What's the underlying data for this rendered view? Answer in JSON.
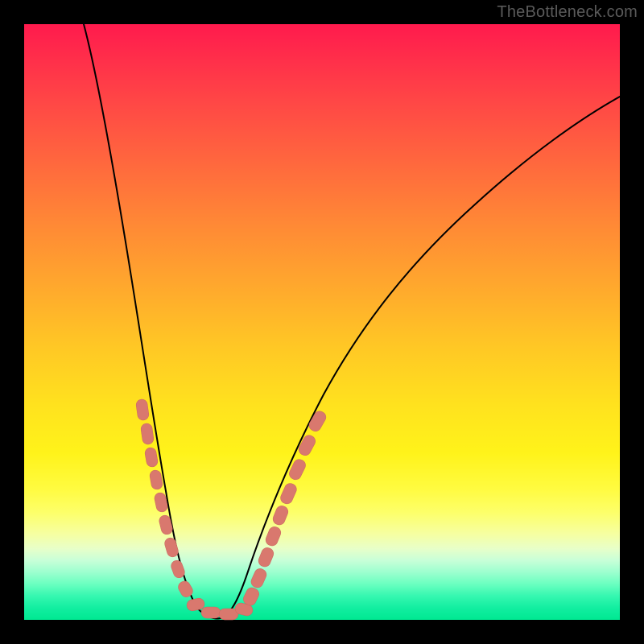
{
  "watermark": "TheBottleneck.com",
  "colors": {
    "curve": "#000000",
    "marker": "#d9786e",
    "gradient_top": "#ff1a4d",
    "gradient_mid": "#ffe21e",
    "gradient_bottom": "#00e892",
    "page_bg": "#000000"
  },
  "chart_data": {
    "type": "line",
    "title": "",
    "xlabel": "",
    "ylabel": "",
    "xlim": [
      0,
      100
    ],
    "ylim": [
      0,
      100
    ],
    "grid": false,
    "legend": false,
    "note": "No axes or tick labels are rendered; x/y interpreted as 0-100% of plot area (y=0 at bottom). Curve is a V-shaped bottleneck dip reaching ~0 around x≈26-34, rising steeply left toward y≈100 at x≈10 and gently right toward y≈78 at x=100.",
    "series": [
      {
        "name": "bottleneck-curve",
        "x": [
          10,
          12,
          14,
          16,
          18,
          20,
          22,
          24,
          26,
          28,
          30,
          32,
          34,
          36,
          38,
          40,
          44,
          48,
          52,
          56,
          60,
          66,
          72,
          78,
          84,
          90,
          96,
          100
        ],
        "y": [
          100,
          88,
          76,
          64,
          52,
          40,
          30,
          20,
          12,
          6,
          2,
          0,
          1,
          4,
          8,
          14,
          24,
          32,
          40,
          46,
          52,
          58,
          63,
          67,
          71,
          74,
          77,
          78
        ]
      }
    ],
    "markers": {
      "name": "highlighted-points",
      "shape": "rounded-pill",
      "comment": "Salmon pill-shaped markers clustered on the lower part of both arms and along the trough.",
      "points": [
        {
          "x": 19.5,
          "y": 36
        },
        {
          "x": 20.5,
          "y": 31
        },
        {
          "x": 21.0,
          "y": 27
        },
        {
          "x": 21.8,
          "y": 23
        },
        {
          "x": 22.6,
          "y": 19
        },
        {
          "x": 23.4,
          "y": 15
        },
        {
          "x": 24.2,
          "y": 11
        },
        {
          "x": 25.2,
          "y": 7
        },
        {
          "x": 26.5,
          "y": 4
        },
        {
          "x": 28.0,
          "y": 2
        },
        {
          "x": 29.5,
          "y": 1
        },
        {
          "x": 31.0,
          "y": 0.5
        },
        {
          "x": 32.5,
          "y": 1
        },
        {
          "x": 34.0,
          "y": 3
        },
        {
          "x": 35.0,
          "y": 6
        },
        {
          "x": 36.0,
          "y": 9
        },
        {
          "x": 37.0,
          "y": 12
        },
        {
          "x": 38.0,
          "y": 15
        },
        {
          "x": 39.2,
          "y": 19
        },
        {
          "x": 40.5,
          "y": 23
        },
        {
          "x": 41.8,
          "y": 27
        },
        {
          "x": 43.2,
          "y": 31
        },
        {
          "x": 44.8,
          "y": 35
        }
      ]
    }
  }
}
